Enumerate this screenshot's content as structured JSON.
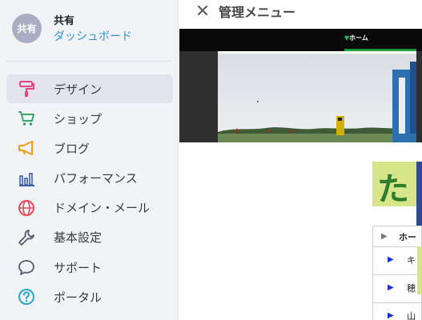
{
  "account": {
    "avatar_text": "共有",
    "name": "共有",
    "dashboard_link": "ダッシュボード"
  },
  "sidebar": {
    "items": [
      {
        "label": "デザイン",
        "icon": "paint-roller-icon",
        "color": "#e0457b",
        "active": true
      },
      {
        "label": "ショップ",
        "icon": "cart-icon",
        "color": "#3aa36b",
        "active": false
      },
      {
        "label": "ブログ",
        "icon": "megaphone-icon",
        "color": "#f29a1a",
        "active": false
      },
      {
        "label": "パフォーマンス",
        "icon": "bar-chart-icon",
        "color": "#3a5fa8",
        "active": false
      },
      {
        "label": "ドメイン・メール",
        "icon": "globe-icon",
        "color": "#e84b5a",
        "active": false
      },
      {
        "label": "基本設定",
        "icon": "wrench-icon",
        "color": "#555b66",
        "active": false
      },
      {
        "label": "サポート",
        "icon": "chat-bubble-icon",
        "color": "#555b66",
        "active": false
      },
      {
        "label": "ポータル",
        "icon": "help-circle-icon",
        "color": "#2aa5c8",
        "active": false
      }
    ]
  },
  "panel": {
    "close_symbol": "×",
    "title": "管理メニュー"
  },
  "preview": {
    "nav_tab": "ホーム",
    "banner_text": "た",
    "menu_items": [
      "ホー",
      "キ",
      "穂",
      "山"
    ]
  },
  "colors": {
    "sidebar_bg": "#f2f3f7",
    "active_bg": "#e2e3ec",
    "link": "#2d8fd5",
    "banner": "#d7e58a"
  }
}
